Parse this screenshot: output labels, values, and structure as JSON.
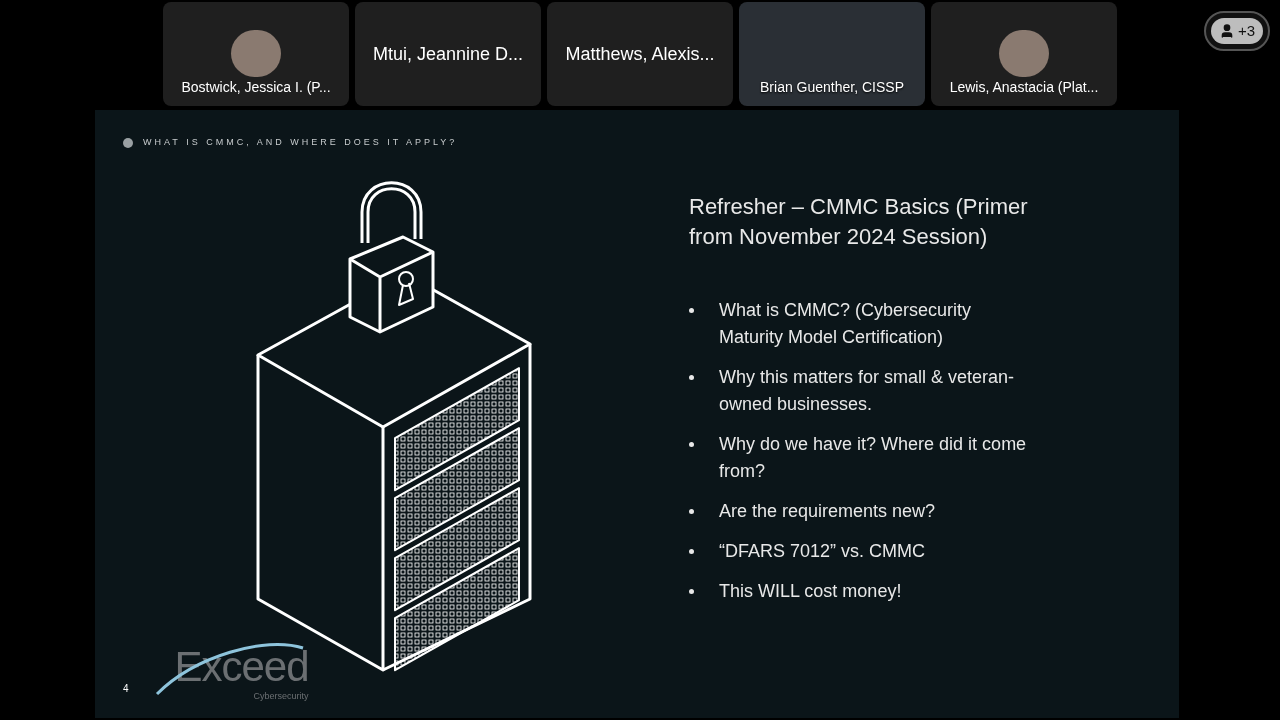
{
  "participants": [
    {
      "kind": "avatar",
      "name": "Bostwick, Jessica I. (P..."
    },
    {
      "kind": "name",
      "name": "Mtui, Jeannine D..."
    },
    {
      "kind": "name",
      "name": "Matthews, Alexis..."
    },
    {
      "kind": "video",
      "name": "Brian Guenther, CISSP"
    },
    {
      "kind": "avatar",
      "name": "Lewis, Anastacia (Plat..."
    }
  ],
  "overflow_button": {
    "label": "+3"
  },
  "slide": {
    "section": "WHAT IS CMMC, AND WHERE DOES IT APPLY?",
    "title": "Refresher – CMMC Basics (Primer from November 2024 Session)",
    "bullets": [
      "What is CMMC? (Cybersecurity Maturity Model Certification)",
      "Why this matters for small & veteran-owned businesses.",
      "Why do we have it? Where did it come from?",
      "Are the requirements new?",
      "“DFARS 7012” vs. CMMC",
      "This WILL cost money!"
    ],
    "page_number": "4",
    "logo": {
      "name": "Exceed",
      "tagline": "Cybersecurity"
    }
  }
}
